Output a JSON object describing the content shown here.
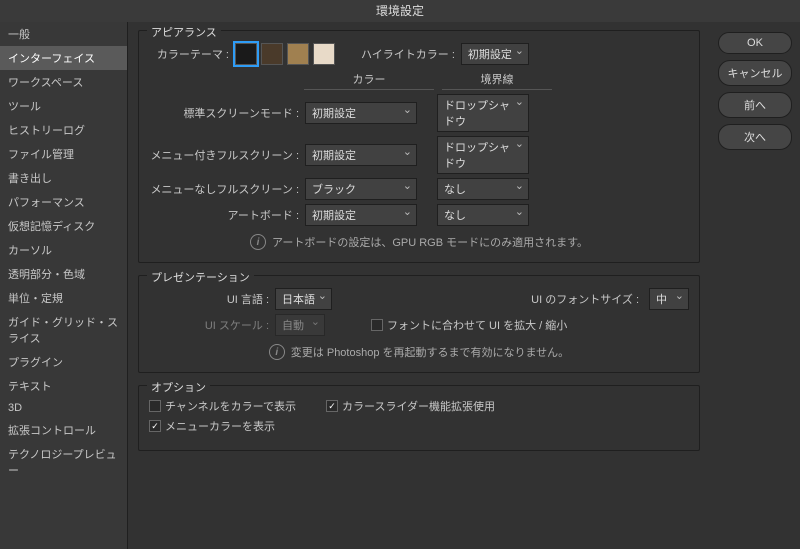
{
  "title": "環境設定",
  "sidebar": {
    "items": [
      "一般",
      "インターフェイス",
      "ワークスペース",
      "ツール",
      "ヒストリーログ",
      "ファイル管理",
      "書き出し",
      "パフォーマンス",
      "仮想記憶ディスク",
      "カーソル",
      "透明部分・色域",
      "単位・定規",
      "ガイド・グリッド・スライス",
      "プラグイン",
      "テキスト",
      "3D",
      "拡張コントロール",
      "テクノロジープレビュー"
    ],
    "selectedIndex": 1
  },
  "buttons": {
    "ok": "OK",
    "cancel": "キャンセル",
    "prev": "前へ",
    "next": "次へ"
  },
  "appearance": {
    "title": "アピアランス",
    "colorThemeLabel": "カラーテーマ :",
    "swatchColors": [
      "#1a1a1a",
      "#4a3a2a",
      "#a08050",
      "#e8dac8"
    ],
    "highlightLabel": "ハイライトカラー :",
    "highlightValue": "初期設定",
    "colHeadColor": "カラー",
    "colHeadBorder": "境界線",
    "rows": [
      {
        "label": "標準スクリーンモード :",
        "color": "初期設定",
        "border": "ドロップシャドウ"
      },
      {
        "label": "メニュー付きフルスクリーン :",
        "color": "初期設定",
        "border": "ドロップシャドウ"
      },
      {
        "label": "メニューなしフルスクリーン :",
        "color": "ブラック",
        "border": "なし"
      },
      {
        "label": "アートボード :",
        "color": "初期設定",
        "border": "なし"
      }
    ],
    "note": "アートボードの設定は、GPU RGB モードにのみ適用されます。"
  },
  "presentation": {
    "title": "プレゼンテーション",
    "langLabel": "UI 言語 :",
    "langValue": "日本語",
    "scaleLabel": "UI スケール :",
    "scaleValue": "自動",
    "fontSizeLabel": "UI のフォントサイズ :",
    "fontSizeValue": "中",
    "scaleToFitLabel": "フォントに合わせて UI を拡大 / 縮小",
    "note": "変更は Photoshop を再起動するまで有効になりません。"
  },
  "options": {
    "title": "オプション",
    "chk1": "チャンネルをカラーで表示",
    "chk2": "カラースライダー機能拡張使用",
    "chk3": "メニューカラーを表示"
  }
}
